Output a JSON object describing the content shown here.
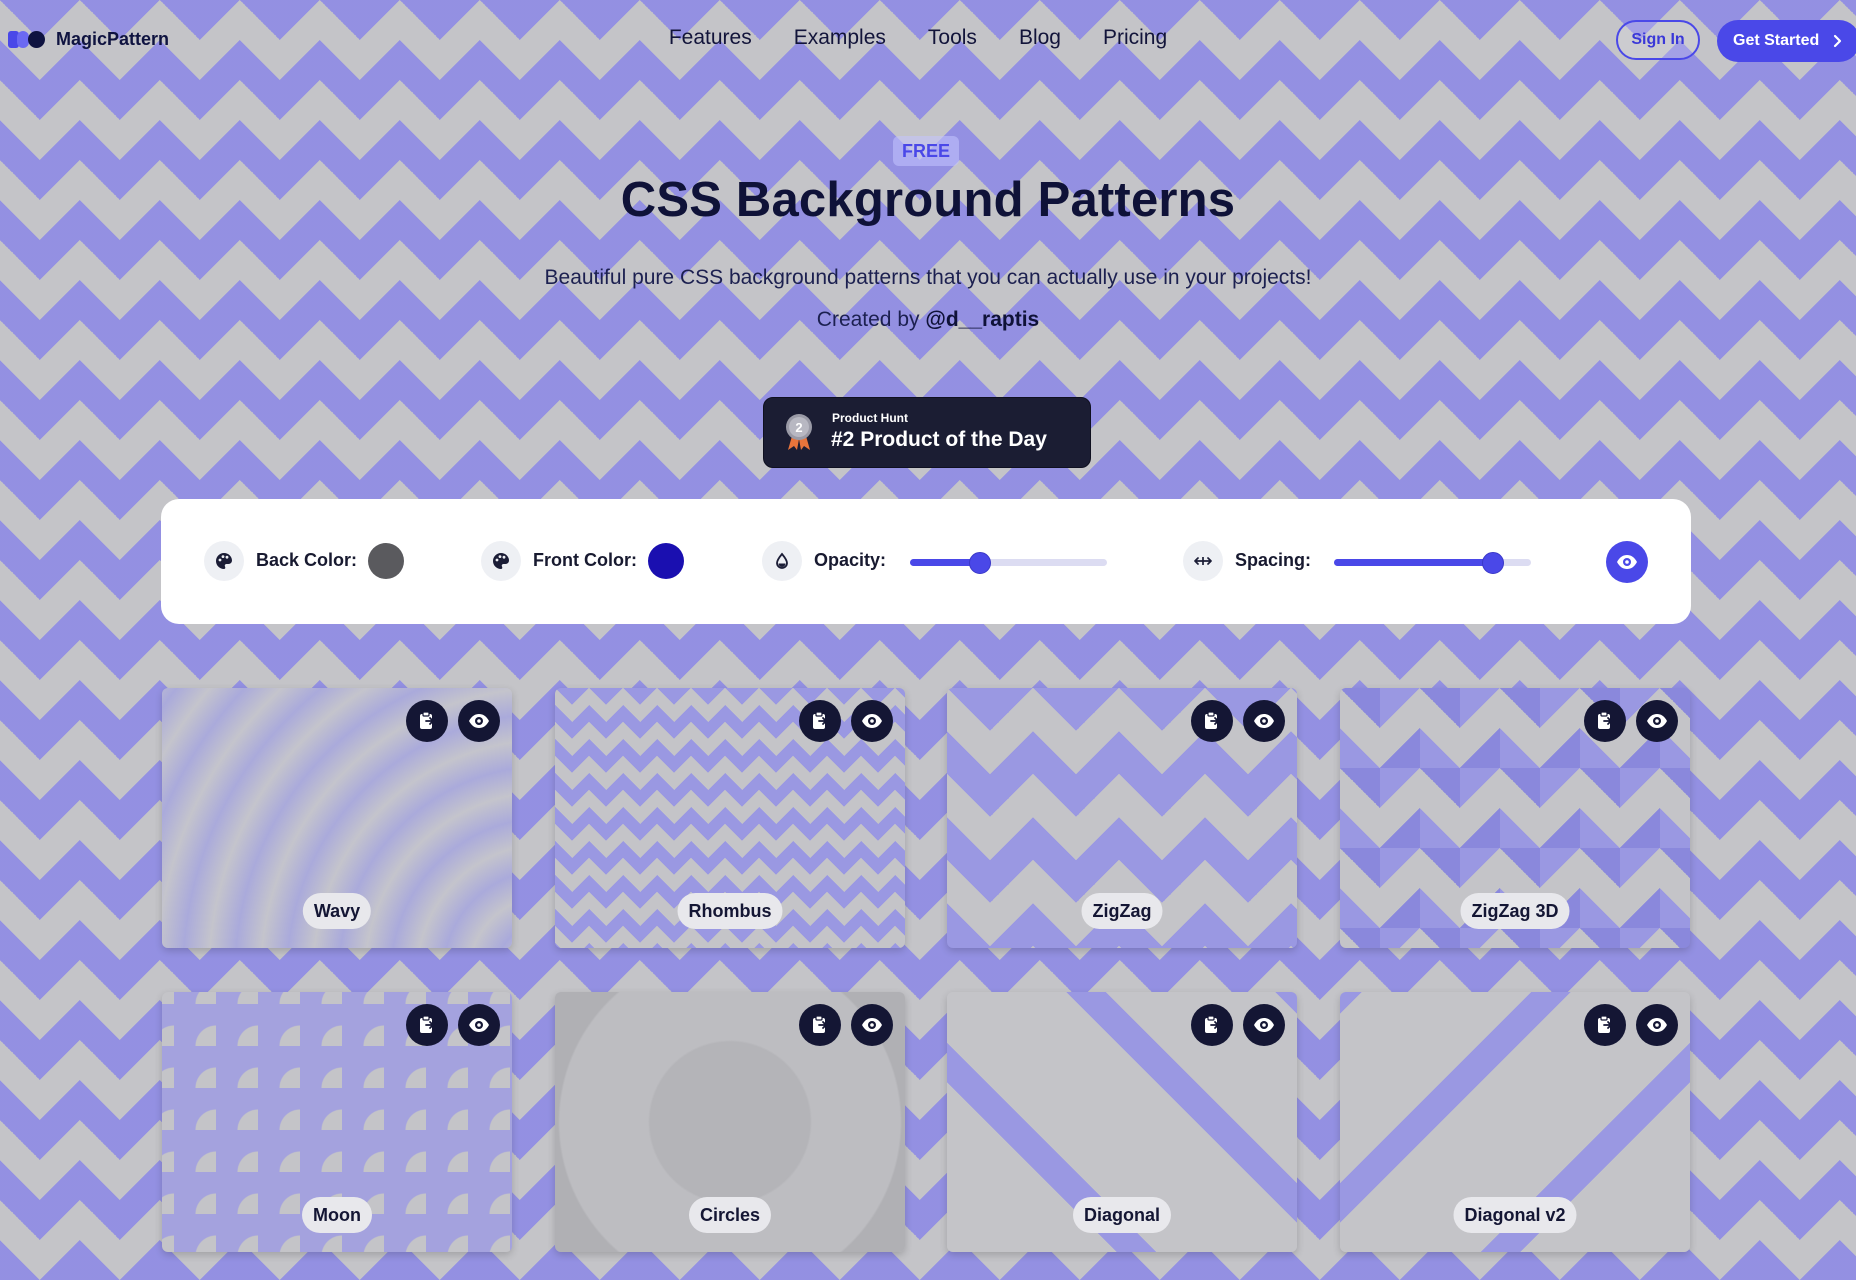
{
  "brand": {
    "name": "MagicPattern"
  },
  "nav": {
    "items": [
      "Features",
      "Examples",
      "Tools",
      "Blog",
      "Pricing"
    ]
  },
  "header": {
    "sign_in": "Sign In",
    "get_started": "Get Started"
  },
  "hero": {
    "badge": "FREE",
    "title": "CSS Background Patterns",
    "subtitle": "Beautiful pure CSS background patterns that you can actually use in your projects!",
    "credit_prefix": "Created by",
    "credit_handle": "@d__raptis"
  },
  "product_hunt": {
    "small": "Product Hunt",
    "big": "#2 Product of the Day",
    "rank": "2"
  },
  "controls": {
    "back_color_label": "Back Color:",
    "back_color_value": "#5a5a5e",
    "front_color_label": "Front Color:",
    "front_color_value": "#1a0fb0",
    "opacity_label": "Opacity:",
    "opacity_value": 0.35,
    "spacing_label": "Spacing:",
    "spacing_value": 0.8
  },
  "colors": {
    "accent": "#4a48e8",
    "dark": "#141634"
  },
  "patterns": [
    {
      "label": "Wavy"
    },
    {
      "label": "Rhombus"
    },
    {
      "label": "ZigZag"
    },
    {
      "label": "ZigZag 3D"
    },
    {
      "label": "Moon"
    },
    {
      "label": "Circles"
    },
    {
      "label": "Diagonal"
    },
    {
      "label": "Diagonal v2"
    }
  ]
}
